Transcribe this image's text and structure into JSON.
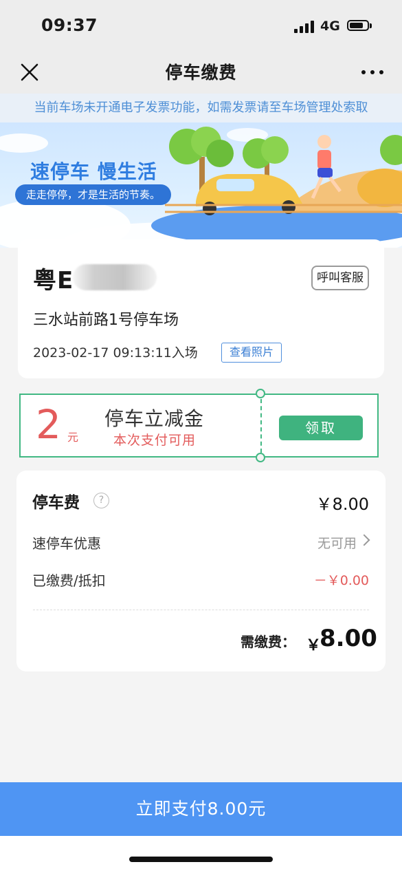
{
  "status_bar": {
    "time": "09:37",
    "network": "4G",
    "battery_level": 0.8
  },
  "nav": {
    "title": "停车缴费",
    "close_icon": "close-icon",
    "more_icon": "more-dots-icon"
  },
  "notice": {
    "text": "当前车场未开通电子发票功能，如需发票请至车场管理处索取"
  },
  "banner": {
    "slogan": "速停车  慢生活",
    "subtitle": "走走停停，才是生活的节奏。"
  },
  "plate_card": {
    "plate_prefix": "粤E",
    "service_button": "呼叫客服",
    "lot_name": "三水站前路1号停车场",
    "entry_time": "2023-02-17 09:13:11入场",
    "photo_button": "查看照片"
  },
  "coupon": {
    "amount": "2",
    "unit": "元",
    "title": "停车立减金",
    "subtitle": "本次支付可用",
    "claim_button": "领取",
    "accent_color": "#41b883"
  },
  "fee": {
    "title": "停车费",
    "help_icon": "question-circle-icon",
    "help_glyph": "?",
    "amount": "￥8.00",
    "discount_label": "速停车优惠",
    "discount_value": "无可用",
    "paid_label": "已缴费/抵扣",
    "paid_value": "－￥0.00",
    "due_label": "需缴费：",
    "due_currency": "￥",
    "due_amount": "8.00"
  },
  "pay_button": {
    "label": "立即支付8.00元",
    "color": "#4f95f3"
  }
}
